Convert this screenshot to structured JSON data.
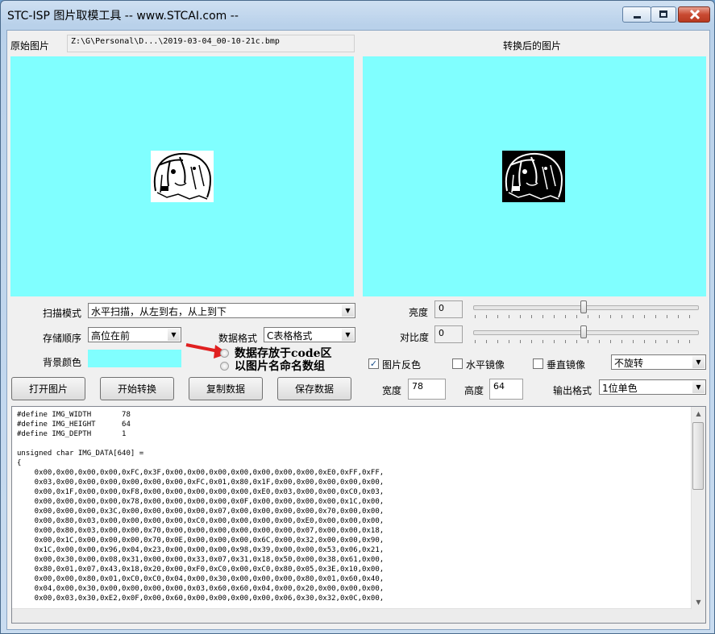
{
  "window": {
    "title": "STC-ISP 图片取模工具 -- www.STCAI.com --"
  },
  "original": {
    "label": "原始图片",
    "path": "Z:\\G\\Personal\\D...\\2019-03-04_00-10-21c.bmp"
  },
  "converted": {
    "label": "转换后的图片"
  },
  "scan_mode": {
    "label": "扫描模式",
    "value": "水平扫描，从左到右，从上到下"
  },
  "storage_order": {
    "label": "存储顺序",
    "value": "高位在前"
  },
  "data_format": {
    "label": "数据格式",
    "value": "C表格格式"
  },
  "background": {
    "label": "背景颜色",
    "color": "#80ffff"
  },
  "radios": {
    "code_area": "数据存放于code区",
    "name_array": "以图片名命名数组"
  },
  "brightness": {
    "label": "亮度",
    "value": "0",
    "level": 0.5
  },
  "contrast": {
    "label": "对比度",
    "value": "0",
    "level": 0.5
  },
  "invert": {
    "label": "图片反色",
    "checked": true
  },
  "hmirror": {
    "label": "水平镜像",
    "checked": false
  },
  "vmirror": {
    "label": "垂直镜像",
    "checked": false
  },
  "rotate": {
    "value": "不旋转"
  },
  "buttons": {
    "open": "打开图片",
    "convert": "开始转换",
    "copy": "复制数据",
    "save": "保存数据"
  },
  "width": {
    "label": "宽度",
    "value": "78"
  },
  "height": {
    "label": "高度",
    "value": "64"
  },
  "output_format": {
    "label": "输出格式",
    "value": "1位单色"
  },
  "code": {
    "lines": [
      "#define IMG_WIDTH       78",
      "#define IMG_HEIGHT      64",
      "#define IMG_DEPTH       1",
      "",
      "unsigned char IMG_DATA[640] =",
      "{",
      "    0x00,0x00,0x00,0x00,0xFC,0x3F,0x00,0x00,0x00,0x00,0x00,0x00,0x00,0xE0,0xFF,0xFF,",
      "    0x03,0x00,0x00,0x00,0x00,0x00,0x00,0xFC,0x01,0x80,0x1F,0x00,0x00,0x00,0x00,0x00,",
      "    0x00,0x1F,0x00,0x00,0xF8,0x00,0x00,0x00,0x00,0x00,0xE0,0x03,0x00,0x00,0xC0,0x03,",
      "    0x00,0x00,0x00,0x00,0x78,0x00,0x00,0x00,0x00,0x0F,0x00,0x00,0x00,0x00,0x1C,0x00,",
      "    0x00,0x00,0x00,0x3C,0x00,0x00,0x00,0x00,0x07,0x00,0x00,0x00,0x00,0x70,0x00,0x00,",
      "    0x00,0x80,0x03,0x00,0x00,0x00,0x00,0xC0,0x00,0x00,0x00,0x00,0xE0,0x00,0x00,0x00,",
      "    0x00,0x80,0x03,0x00,0x00,0x70,0x00,0x00,0x00,0x00,0x00,0x00,0x07,0x00,0x00,0x18,",
      "    0x00,0x1C,0x00,0x00,0x00,0x70,0x0E,0x00,0x00,0x00,0x6C,0x00,0x32,0x00,0x00,0x90,",
      "    0x1C,0x00,0x00,0x96,0x04,0x23,0x00,0x00,0x00,0x98,0x39,0x00,0x00,0x53,0x06,0x21,",
      "    0x00,0x30,0x00,0x08,0x31,0x00,0x00,0x33,0x07,0x31,0x18,0x50,0x00,0x38,0x61,0x00,",
      "    0x80,0x01,0x07,0x43,0x18,0x20,0x00,0xF0,0xC0,0x00,0xC0,0x80,0x05,0x3E,0x10,0x00,",
      "    0x00,0x00,0x80,0x01,0xC0,0xC0,0x04,0x00,0x30,0x00,0x00,0x00,0x80,0x01,0x60,0x40,",
      "    0x04,0x00,0x30,0x00,0x00,0x00,0x00,0x03,0x60,0x60,0x04,0x00,0x20,0x00,0x00,0x00,",
      "    0x00,0x03,0x30,0xE2,0x0F,0x00,0x60,0x00,0x00,0x00,0x00,0x06,0x30,0x32,0x0C,0x00,"
    ]
  }
}
